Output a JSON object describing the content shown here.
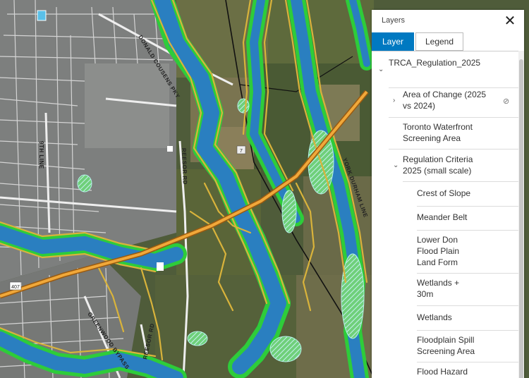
{
  "map": {
    "road_labels": {
      "donald_cousens": "DONALD COUSENS PKY",
      "ninth_line": "9TH LINE",
      "reesor": "REESOR RD",
      "york_durham": "YORK DURHAM LINE",
      "greenwood": "REESOR RD",
      "bypass": "GREENWOOD BYPASS",
      "shield_407": "407",
      "shield_7": "7"
    },
    "colors": {
      "flood": "#2a7fc0",
      "buffer": "#2ecc3a",
      "slope": "#d9b33b",
      "wetland": "#8fd0d8",
      "highway": "#e8a23a"
    }
  },
  "panel": {
    "title": "Layers",
    "tabs": {
      "layer": "Layer",
      "legend": "Legend"
    },
    "root": "TRCA_Regulation_2025",
    "items": {
      "area_change": "Area of Change (2025 vs 2024)",
      "toronto": "Toronto Waterfront Screening Area",
      "criteria": "Regulation Criteria 2025 (small scale)",
      "crest": "Crest of Slope",
      "meander": "Meander Belt",
      "lower_don": "Lower Don Flood Plain Land Form",
      "wetlands30": "Wetlands + 30m",
      "wetlands": "Wetlands",
      "floodplain_spill": "Floodplain Spill Screening Area",
      "flood_hazard": "Flood Hazard"
    }
  }
}
